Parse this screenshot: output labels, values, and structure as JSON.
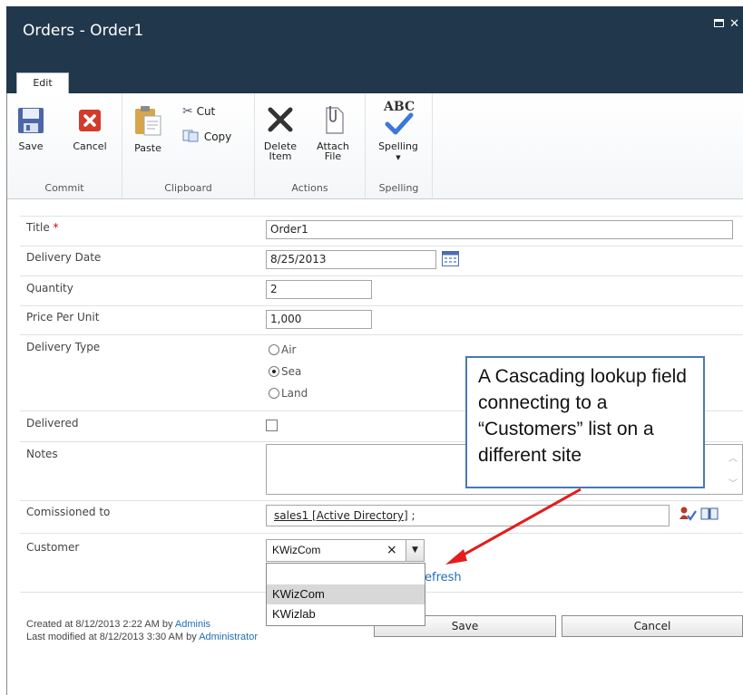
{
  "window": {
    "title": "Orders - Order1"
  },
  "ribbon": {
    "tab": "Edit",
    "groups": {
      "commit": {
        "label": "Commit",
        "save": "Save",
        "cancel": "Cancel"
      },
      "clipboard": {
        "label": "Clipboard",
        "paste": "Paste",
        "cut": "Cut",
        "copy": "Copy"
      },
      "actions": {
        "label": "Actions",
        "delete_line1": "Delete",
        "delete_line2": "Item",
        "attach_line1": "Attach",
        "attach_line2": "File"
      },
      "spelling": {
        "label": "Spelling",
        "spelling": "Spelling",
        "abc": "ABC"
      }
    }
  },
  "form": {
    "title": {
      "label": "Title",
      "required_mark": "*",
      "value": "Order1"
    },
    "delivery_date": {
      "label": "Delivery Date",
      "value": "8/25/2013"
    },
    "quantity": {
      "label": "Quantity",
      "value": "2"
    },
    "price_per_unit": {
      "label": "Price Per Unit",
      "value": "1,000"
    },
    "delivery_type": {
      "label": "Delivery Type",
      "options": [
        "Air",
        "Sea",
        "Land"
      ],
      "selected": "Sea"
    },
    "delivered": {
      "label": "Delivered",
      "checked": false
    },
    "notes": {
      "label": "Notes",
      "value": ""
    },
    "comissioned_to": {
      "label": "Comissioned to",
      "value": "sales1 [Active Directory]",
      "suffix": " ;"
    },
    "customer": {
      "label": "Customer",
      "value": "KWizCom",
      "clear": "×",
      "options": [
        "",
        "KWizCom",
        "KWizlab"
      ],
      "highlighted": "KWizCom",
      "refresh_text": "efresh"
    }
  },
  "footer": {
    "created_prefix": "Created at 8/12/2013 2:22 AM by ",
    "created_by": "Adminis",
    "modified_prefix": "Last modified at 8/12/2013 3:30 AM by ",
    "modified_by": "Administrator",
    "save": "Save",
    "cancel": "Cancel"
  },
  "callout": {
    "text": "A Cascading lookup field connecting to a “Customers” list on a different site"
  },
  "colors": {
    "titlebar": "#21374c",
    "link": "#1f6fb5",
    "callout_border": "#4a78b4",
    "arrow": "#e31d1d",
    "required": "#cc0000"
  }
}
